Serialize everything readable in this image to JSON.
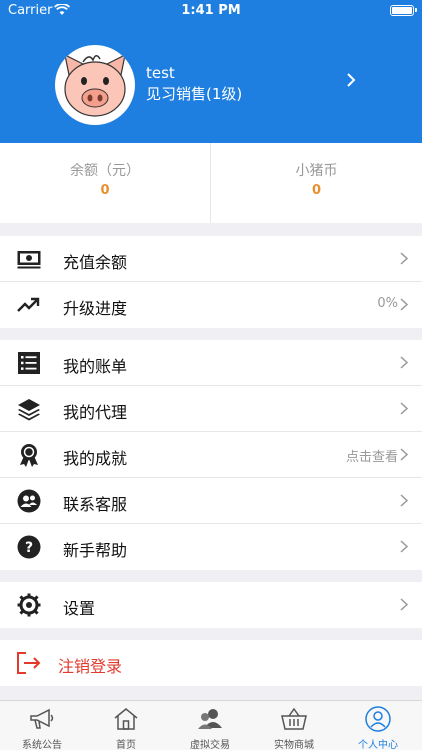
{
  "status_bar": {
    "carrier": "Carrier",
    "time": "1:41 PM"
  },
  "profile": {
    "username": "test",
    "level": "见习销售(1级)"
  },
  "balance": {
    "left": {
      "label": "余额（元）",
      "value": "0"
    },
    "right": {
      "label": "小猪币",
      "value": "0"
    }
  },
  "menu": {
    "recharge": {
      "label": "充值余额"
    },
    "upgrade": {
      "label": "升级进度",
      "value": "0%"
    },
    "bill": {
      "label": "我的账单"
    },
    "agent": {
      "label": "我的代理"
    },
    "achievement": {
      "label": "我的成就",
      "value": "点击查看"
    },
    "service": {
      "label": "联系客服"
    },
    "help": {
      "label": "新手帮助"
    },
    "settings": {
      "label": "设置"
    },
    "logout": {
      "label": "注销登录"
    }
  },
  "tabs": [
    {
      "label": "系统公告",
      "icon": "megaphone-icon"
    },
    {
      "label": "首页",
      "icon": "home-icon"
    },
    {
      "label": "虚拟交易",
      "icon": "users-icon"
    },
    {
      "label": "实物商城",
      "icon": "basket-icon"
    },
    {
      "label": "个人中心",
      "icon": "user-icon",
      "active": true
    }
  ],
  "colors": {
    "primary": "#1e7fe0",
    "accent": "#e8902f",
    "danger": "#e23b2e"
  }
}
